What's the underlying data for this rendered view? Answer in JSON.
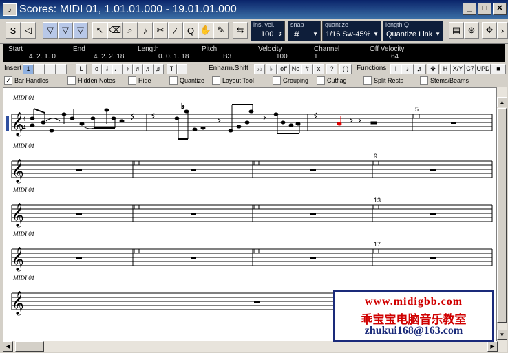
{
  "window": {
    "title": "Scores: MIDI 01, 1.01.01.000 - 19.01.01.000"
  },
  "toolbar": {
    "ins_vel": {
      "label": "ins. vel.",
      "value": "100"
    },
    "snap": {
      "label": "snap",
      "value": "#"
    },
    "quantize": {
      "label": "quantize",
      "value": "1/16 Sw-45%"
    },
    "length_q": {
      "label": "length Q",
      "value": "Quantize Link"
    }
  },
  "info_line": {
    "headers": [
      "Start",
      "End",
      "Length",
      "Pitch",
      "Velocity",
      "Channel",
      "Off Velocity"
    ],
    "values": [
      "4. 2. 1.   0",
      "4. 2. 2. 18",
      "0. 0. 1. 18",
      "B3",
      "100",
      "1",
      "64"
    ]
  },
  "row3": {
    "insert_label": "Insert",
    "insert_value": "1",
    "enharm_label": "Enharm.Shift",
    "enharm_buttons": [
      "off",
      "No",
      "#",
      "x",
      "?",
      "( )"
    ],
    "functions_label": "Functions",
    "function_buttons": [
      "i",
      "H",
      "X/Y",
      "C7",
      "UPD"
    ]
  },
  "options": [
    {
      "label": "Bar Handles",
      "checked": true
    },
    {
      "label": "Hidden Notes",
      "checked": false
    },
    {
      "label": "Hide",
      "checked": false
    },
    {
      "label": "Quantize",
      "checked": false
    },
    {
      "label": "Layout Tool",
      "checked": false
    },
    {
      "label": "Grouping",
      "checked": false
    },
    {
      "label": "Cutflag",
      "checked": false
    },
    {
      "label": "Split Rests",
      "checked": false
    },
    {
      "label": "Stems/Beams",
      "checked": false
    }
  ],
  "score": {
    "staff_label": "MIDI 01",
    "bar_numbers": [
      "5",
      "9",
      "13",
      "17"
    ]
  },
  "watermark": {
    "line1": "www.midigbb.com",
    "line2": "乖宝宝电脑音乐教室",
    "line3": "zhukui168@163.com"
  }
}
